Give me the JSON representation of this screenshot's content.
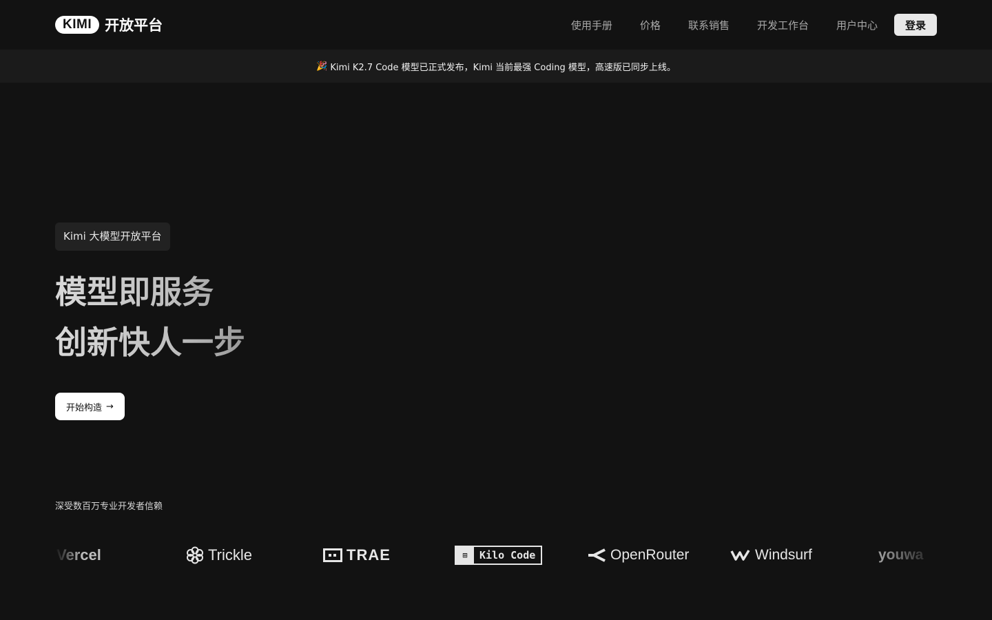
{
  "nav": {
    "brand_pill": "KIMI",
    "brand_text": "开放平台",
    "links": [
      "使用手册",
      "价格",
      "联系销售",
      "开发工作台",
      "用户中心"
    ],
    "login": "登录"
  },
  "announcement": {
    "emoji": "🎉",
    "text": "Kimi K2.7 Code 模型已正式发布，Kimi 当前最强 Coding 模型，高速版已同步上线。"
  },
  "hero": {
    "badge": "Kimi 大模型开放平台",
    "headline_line1": "模型即服务",
    "headline_line2": "创新快人一步",
    "cta_label": "开始构造",
    "cta_arrow": "→"
  },
  "trust": {
    "text": "深受数百万专业开发者信赖",
    "logos": [
      "Vercel",
      "Trickle",
      "TRAE",
      "Kilo Code",
      "OpenRouter",
      "Windsurf",
      "youwa"
    ]
  },
  "colors": {
    "background": "#121212",
    "announcement_bg": "#1b1b1b",
    "login_bg": "#e8e8e8"
  }
}
